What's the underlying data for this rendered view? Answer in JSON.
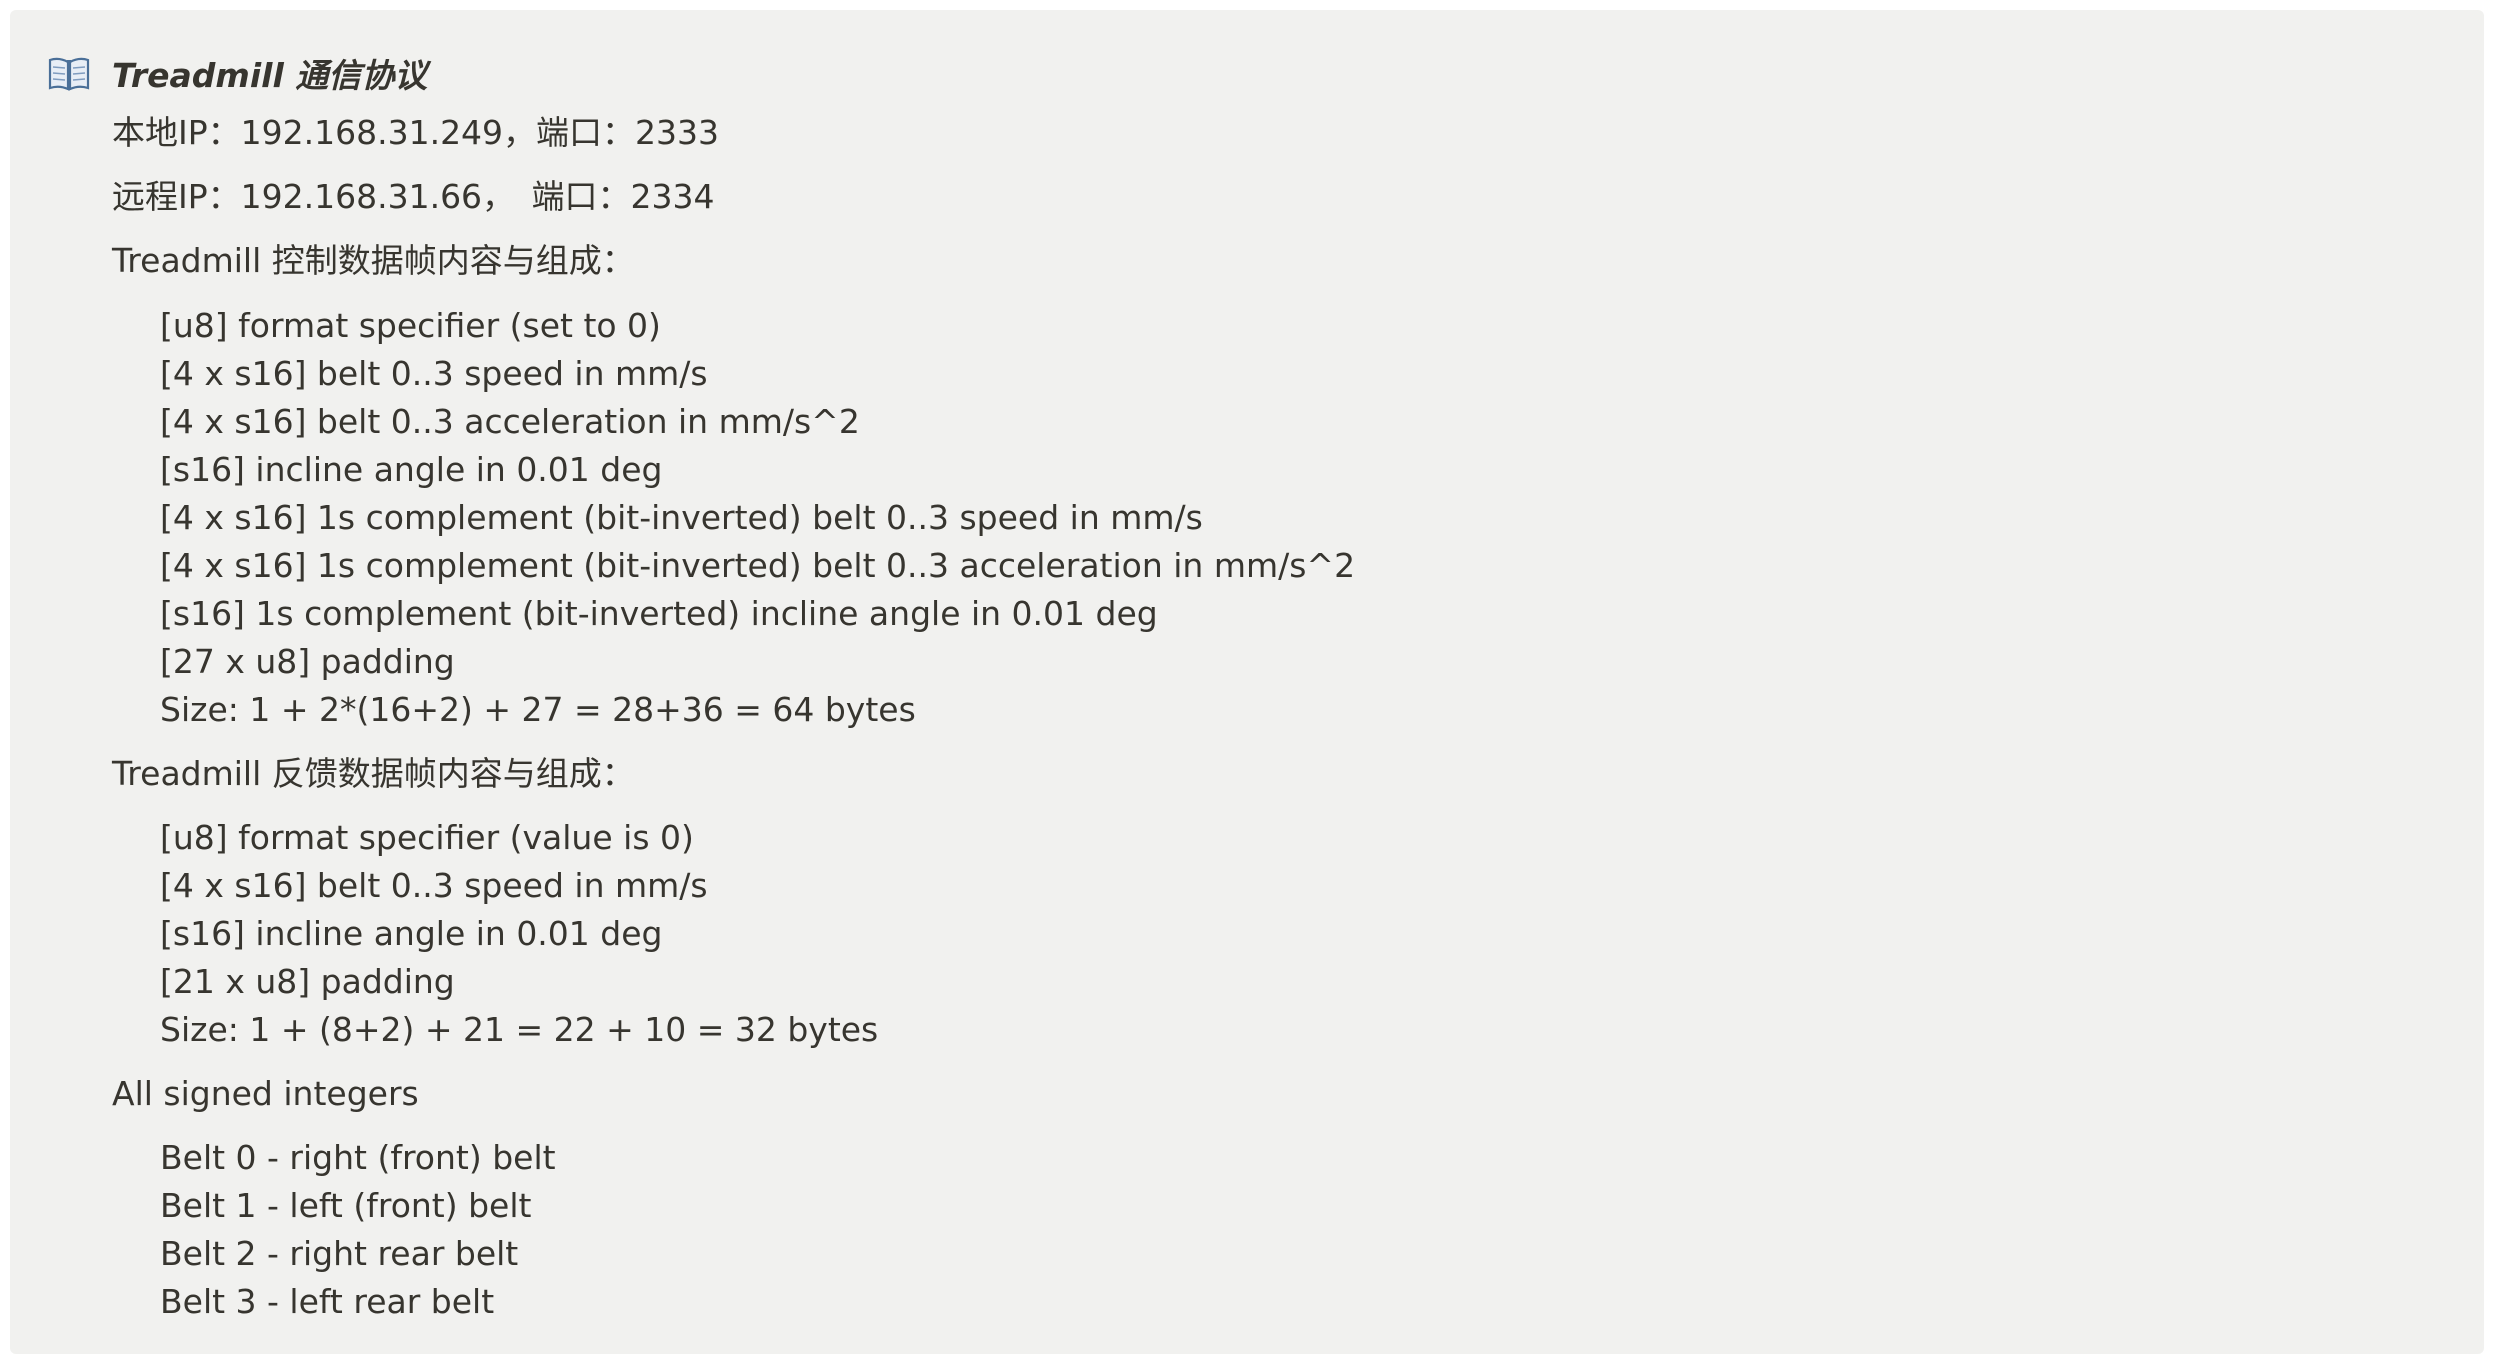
{
  "callout": {
    "icon": "open-book-icon",
    "title": "Treadmill 通信协议",
    "local_ip": "本地IP：192.168.31.249，端口：2333",
    "remote_ip": "远程IP：192.168.31.66，　端口：2334",
    "control_heading": "Treadmill 控制数据帧内容与组成：",
    "control_items": [
      "[u8] format specifier (set to 0)",
      "[4 x s16] belt 0..3 speed in mm/s",
      "[4 x s16] belt 0..3 acceleration in mm/s^2",
      "[s16] incline angle in 0.01 deg",
      "[4 x s16] 1s complement (bit-inverted) belt 0..3 speed in mm/s",
      "[4 x s16] 1s complement (bit-inverted) belt 0..3 acceleration in mm/s^2",
      "[s16] 1s complement (bit-inverted) incline angle in 0.01 deg",
      "[27 x u8] padding",
      "Size: 1 + 2*(16+2) + 27 = 28+36 = 64 bytes"
    ],
    "feedback_heading": "Treadmill 反馈数据帧内容与组成：",
    "feedback_items": [
      "[u8] format specifier (value is 0)",
      "[4 x s16] belt 0..3 speed in mm/s",
      "[s16] incline angle in 0.01 deg",
      "[21 x u8] padding",
      "Size: 1 + (8+2) + 21 = 22 + 10 = 32 bytes"
    ],
    "signed_heading": "All signed integers",
    "belt_items": [
      "Belt 0 - right (front) belt",
      "Belt 1 - left (front) belt",
      "Belt 2 - right rear belt",
      "Belt 3 - left rear belt"
    ]
  }
}
